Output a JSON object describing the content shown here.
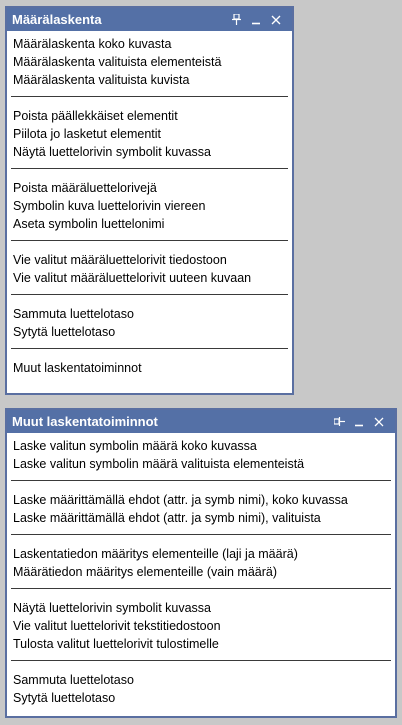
{
  "panel1": {
    "title": "Määrälaskenta",
    "groups": [
      [
        "Määrälaskenta koko kuvasta",
        "Määrälaskenta valituista elementeistä",
        "Määrälaskenta valituista kuvista"
      ],
      [
        "Poista päällekkäiset elementit",
        "Piilota jo lasketut elementit",
        "Näytä luettelorivin symbolit kuvassa"
      ],
      [
        "Poista määräluettelorivejä",
        "Symbolin kuva luettelorivin viereen",
        "Aseta symbolin luettelonimi"
      ],
      [
        "Vie valitut määräluettelorivit tiedostoon",
        "Vie valitut määräluettelorivit uuteen kuvaan"
      ],
      [
        "Sammuta luettelotaso",
        "Sytytä luettelotaso"
      ],
      [
        "Muut laskentatoiminnot"
      ]
    ]
  },
  "panel2": {
    "title": "Muut laskentatoiminnot",
    "groups": [
      [
        "Laske valitun symbolin määrä koko kuvassa",
        "Laske valitun symbolin määrä valituista elementeistä"
      ],
      [
        "Laske määrittämällä ehdot (attr. ja symb nimi), koko kuvassa",
        "Laske määrittämällä ehdot (attr. ja symb nimi), valituista"
      ],
      [
        "Laskentatiedon määritys elementeille (laji ja määrä)",
        "Määrätiedon määritys elementeille (vain määrä)"
      ],
      [
        "Näytä luettelorivin symbolit kuvassa",
        "Vie valitut luettelorivit tekstitiedostoon",
        "Tulosta valitut luettelorivit tulostimelle"
      ],
      [
        "Sammuta luettelotaso",
        "Sytytä luettelotaso"
      ]
    ]
  },
  "colors": {
    "titlebar": "#5470a6",
    "border": "#5a6fa1",
    "background": "#c8c8c8"
  },
  "icons": [
    "pin-icon",
    "minimize-icon",
    "close-icon"
  ]
}
